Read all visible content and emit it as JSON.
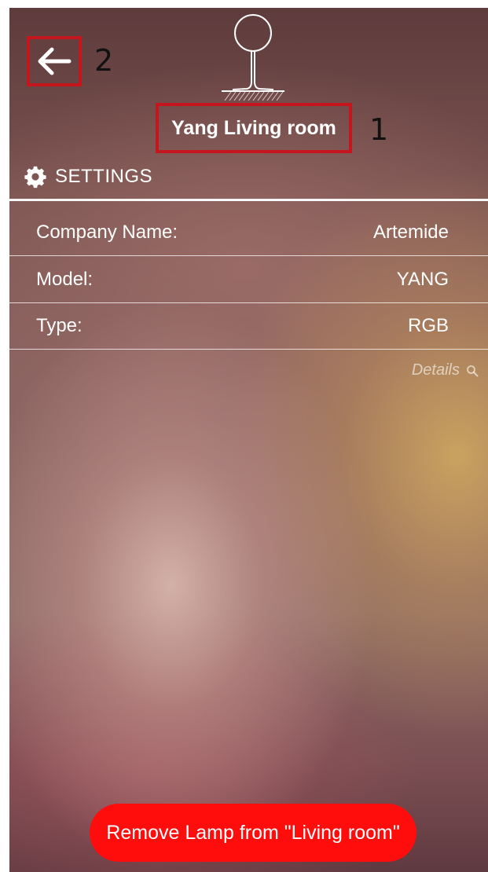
{
  "header": {
    "title": "Yang Living room",
    "lamp_icon": "pendant-lamp-icon",
    "back_icon": "arrow-left-icon"
  },
  "callouts": {
    "title": "1",
    "back": "2"
  },
  "settings": {
    "icon": "gear-icon",
    "label": "SETTINGS",
    "rows": [
      {
        "key": "Company Name:",
        "value": "Artemide"
      },
      {
        "key": "Model:",
        "value": "YANG"
      },
      {
        "key": "Type:",
        "value": "RGB"
      }
    ],
    "details_label": "Details",
    "details_icon": "search-icon"
  },
  "actions": {
    "remove_label": "Remove Lamp from \"Living room\""
  },
  "colors": {
    "highlight_box": "#c4161c",
    "remove_button": "#ff0c0c",
    "text": "#ffffff"
  }
}
